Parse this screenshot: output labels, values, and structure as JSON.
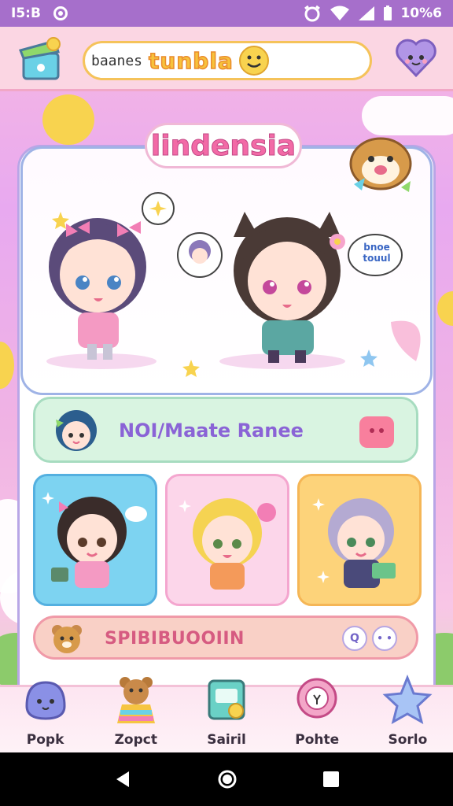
{
  "status_bar": {
    "time": "I5:B",
    "battery": "10%6"
  },
  "search": {
    "prefix": "baanes",
    "brand": "tunbla"
  },
  "hero": {
    "title": "lindensia",
    "speech_text": "bnoe touul"
  },
  "banner": {
    "title": "NOI/Maate Ranee"
  },
  "pill": {
    "label": "SPIBIBUOOIIN",
    "button_1": "Q"
  },
  "bottom_nav": [
    {
      "label": "Popk",
      "icon": "ghost-blob-icon"
    },
    {
      "label": "Zopct",
      "icon": "bear-icon"
    },
    {
      "label": "Sairil",
      "icon": "note-box-icon"
    },
    {
      "label": "Pohte",
      "icon": "ring-bubble-icon"
    },
    {
      "label": "Sorlo",
      "icon": "star-icon"
    }
  ],
  "colors": {
    "accent": "#a66fcb",
    "pink": "#f26aa6",
    "banner": "#d9f4e1"
  }
}
